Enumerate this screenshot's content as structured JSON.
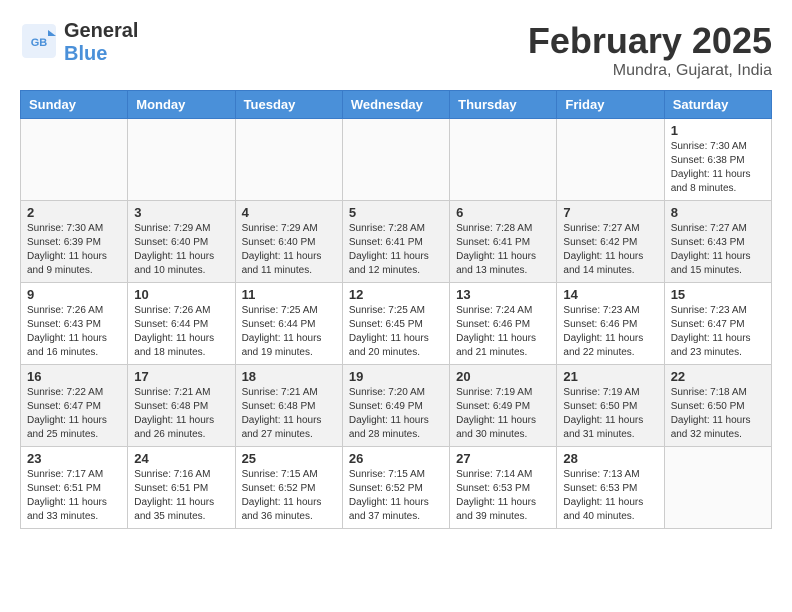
{
  "header": {
    "logo_line1": "General",
    "logo_line2": "Blue",
    "month_year": "February 2025",
    "location": "Mundra, Gujarat, India"
  },
  "days_of_week": [
    "Sunday",
    "Monday",
    "Tuesday",
    "Wednesday",
    "Thursday",
    "Friday",
    "Saturday"
  ],
  "weeks": [
    [
      {
        "day": "",
        "info": ""
      },
      {
        "day": "",
        "info": ""
      },
      {
        "day": "",
        "info": ""
      },
      {
        "day": "",
        "info": ""
      },
      {
        "day": "",
        "info": ""
      },
      {
        "day": "",
        "info": ""
      },
      {
        "day": "1",
        "info": "Sunrise: 7:30 AM\nSunset: 6:38 PM\nDaylight: 11 hours\nand 8 minutes."
      }
    ],
    [
      {
        "day": "2",
        "info": "Sunrise: 7:30 AM\nSunset: 6:39 PM\nDaylight: 11 hours\nand 9 minutes."
      },
      {
        "day": "3",
        "info": "Sunrise: 7:29 AM\nSunset: 6:40 PM\nDaylight: 11 hours\nand 10 minutes."
      },
      {
        "day": "4",
        "info": "Sunrise: 7:29 AM\nSunset: 6:40 PM\nDaylight: 11 hours\nand 11 minutes."
      },
      {
        "day": "5",
        "info": "Sunrise: 7:28 AM\nSunset: 6:41 PM\nDaylight: 11 hours\nand 12 minutes."
      },
      {
        "day": "6",
        "info": "Sunrise: 7:28 AM\nSunset: 6:41 PM\nDaylight: 11 hours\nand 13 minutes."
      },
      {
        "day": "7",
        "info": "Sunrise: 7:27 AM\nSunset: 6:42 PM\nDaylight: 11 hours\nand 14 minutes."
      },
      {
        "day": "8",
        "info": "Sunrise: 7:27 AM\nSunset: 6:43 PM\nDaylight: 11 hours\nand 15 minutes."
      }
    ],
    [
      {
        "day": "9",
        "info": "Sunrise: 7:26 AM\nSunset: 6:43 PM\nDaylight: 11 hours\nand 16 minutes."
      },
      {
        "day": "10",
        "info": "Sunrise: 7:26 AM\nSunset: 6:44 PM\nDaylight: 11 hours\nand 18 minutes."
      },
      {
        "day": "11",
        "info": "Sunrise: 7:25 AM\nSunset: 6:44 PM\nDaylight: 11 hours\nand 19 minutes."
      },
      {
        "day": "12",
        "info": "Sunrise: 7:25 AM\nSunset: 6:45 PM\nDaylight: 11 hours\nand 20 minutes."
      },
      {
        "day": "13",
        "info": "Sunrise: 7:24 AM\nSunset: 6:46 PM\nDaylight: 11 hours\nand 21 minutes."
      },
      {
        "day": "14",
        "info": "Sunrise: 7:23 AM\nSunset: 6:46 PM\nDaylight: 11 hours\nand 22 minutes."
      },
      {
        "day": "15",
        "info": "Sunrise: 7:23 AM\nSunset: 6:47 PM\nDaylight: 11 hours\nand 23 minutes."
      }
    ],
    [
      {
        "day": "16",
        "info": "Sunrise: 7:22 AM\nSunset: 6:47 PM\nDaylight: 11 hours\nand 25 minutes."
      },
      {
        "day": "17",
        "info": "Sunrise: 7:21 AM\nSunset: 6:48 PM\nDaylight: 11 hours\nand 26 minutes."
      },
      {
        "day": "18",
        "info": "Sunrise: 7:21 AM\nSunset: 6:48 PM\nDaylight: 11 hours\nand 27 minutes."
      },
      {
        "day": "19",
        "info": "Sunrise: 7:20 AM\nSunset: 6:49 PM\nDaylight: 11 hours\nand 28 minutes."
      },
      {
        "day": "20",
        "info": "Sunrise: 7:19 AM\nSunset: 6:49 PM\nDaylight: 11 hours\nand 30 minutes."
      },
      {
        "day": "21",
        "info": "Sunrise: 7:19 AM\nSunset: 6:50 PM\nDaylight: 11 hours\nand 31 minutes."
      },
      {
        "day": "22",
        "info": "Sunrise: 7:18 AM\nSunset: 6:50 PM\nDaylight: 11 hours\nand 32 minutes."
      }
    ],
    [
      {
        "day": "23",
        "info": "Sunrise: 7:17 AM\nSunset: 6:51 PM\nDaylight: 11 hours\nand 33 minutes."
      },
      {
        "day": "24",
        "info": "Sunrise: 7:16 AM\nSunset: 6:51 PM\nDaylight: 11 hours\nand 35 minutes."
      },
      {
        "day": "25",
        "info": "Sunrise: 7:15 AM\nSunset: 6:52 PM\nDaylight: 11 hours\nand 36 minutes."
      },
      {
        "day": "26",
        "info": "Sunrise: 7:15 AM\nSunset: 6:52 PM\nDaylight: 11 hours\nand 37 minutes."
      },
      {
        "day": "27",
        "info": "Sunrise: 7:14 AM\nSunset: 6:53 PM\nDaylight: 11 hours\nand 39 minutes."
      },
      {
        "day": "28",
        "info": "Sunrise: 7:13 AM\nSunset: 6:53 PM\nDaylight: 11 hours\nand 40 minutes."
      },
      {
        "day": "",
        "info": ""
      }
    ]
  ]
}
